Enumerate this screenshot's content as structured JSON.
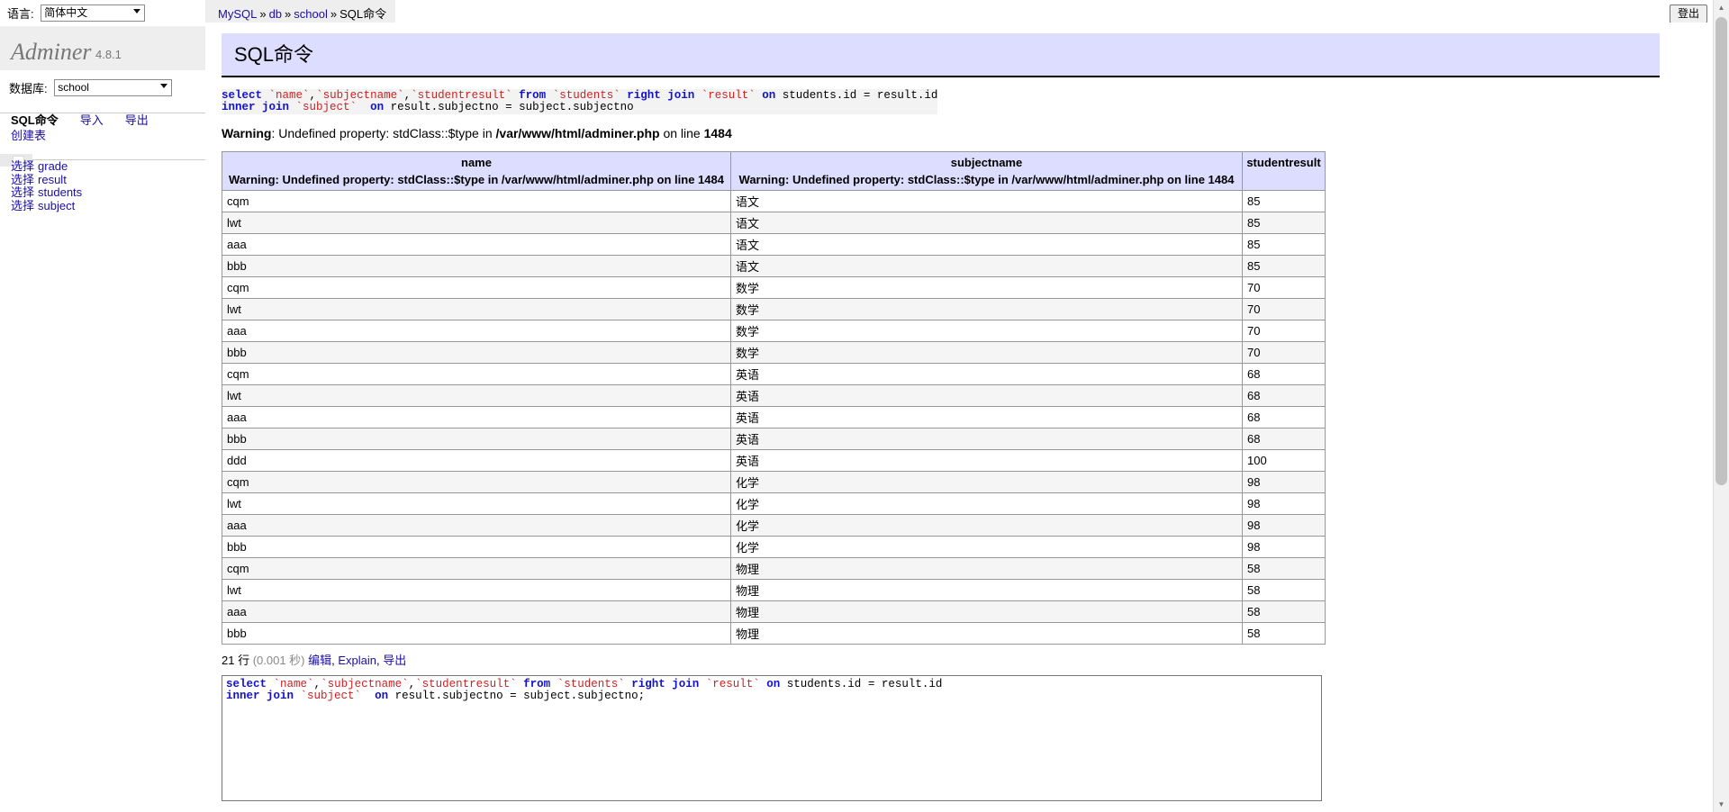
{
  "window": {
    "language_label": "语言:",
    "language_value": "简体中文",
    "logout_label": "登出"
  },
  "breadcrumb": {
    "server": "MySQL",
    "db_link": "db",
    "database": "school",
    "sep": "»",
    "current": "SQL命令"
  },
  "sidebar": {
    "logo": "Adminer",
    "version": "4.8.1",
    "db_label": "数据库:",
    "db_value": "school",
    "nav": {
      "sql_command": "SQL命令",
      "import": "导入",
      "export": "导出",
      "create_table": "创建表"
    },
    "select_label": "选择",
    "tables": [
      {
        "name": "grade"
      },
      {
        "name": "result"
      },
      {
        "name": "students"
      },
      {
        "name": "subject"
      }
    ]
  },
  "main": {
    "title": "SQL命令",
    "query_tokens_line1": [
      {
        "t": "select",
        "c": "kw"
      },
      {
        "t": " ",
        "c": "pl"
      },
      {
        "t": "`name`",
        "c": "id"
      },
      {
        "t": ",",
        "c": "pl"
      },
      {
        "t": "`subjectname`",
        "c": "id"
      },
      {
        "t": ",",
        "c": "pl"
      },
      {
        "t": "`studentresult`",
        "c": "id"
      },
      {
        "t": " ",
        "c": "pl"
      },
      {
        "t": "from",
        "c": "kw"
      },
      {
        "t": " ",
        "c": "pl"
      },
      {
        "t": "`students`",
        "c": "id"
      },
      {
        "t": " ",
        "c": "pl"
      },
      {
        "t": "right join",
        "c": "kw"
      },
      {
        "t": " ",
        "c": "pl"
      },
      {
        "t": "`result`",
        "c": "id"
      },
      {
        "t": " ",
        "c": "pl"
      },
      {
        "t": "on",
        "c": "kw"
      },
      {
        "t": " students.id = result.id",
        "c": "pl"
      }
    ],
    "query_tokens_line2": [
      {
        "t": "inner join",
        "c": "kw"
      },
      {
        "t": " ",
        "c": "pl"
      },
      {
        "t": "`subject`",
        "c": "id"
      },
      {
        "t": "  ",
        "c": "pl"
      },
      {
        "t": "on",
        "c": "kw"
      },
      {
        "t": " result.subjectno = subject.subjectno",
        "c": "pl"
      }
    ],
    "warning": {
      "label": "Warning",
      "colon": ": ",
      "message": "Undefined property: stdClass::$type in ",
      "file": "/var/www/html/adminer.php",
      "on_line": " on line ",
      "line_number": "1484"
    },
    "header_warning_text": "Warning:  Undefined property: stdClass::$type in /var/www/html/adminer.php on line 1484",
    "columns": [
      "name",
      "subjectname",
      "studentresult"
    ],
    "rows": [
      [
        "cqm",
        "语文",
        "85"
      ],
      [
        "lwt",
        "语文",
        "85"
      ],
      [
        "aaa",
        "语文",
        "85"
      ],
      [
        "bbb",
        "语文",
        "85"
      ],
      [
        "cqm",
        "数学",
        "70"
      ],
      [
        "lwt",
        "数学",
        "70"
      ],
      [
        "aaa",
        "数学",
        "70"
      ],
      [
        "bbb",
        "数学",
        "70"
      ],
      [
        "cqm",
        "英语",
        "68"
      ],
      [
        "lwt",
        "英语",
        "68"
      ],
      [
        "aaa",
        "英语",
        "68"
      ],
      [
        "bbb",
        "英语",
        "68"
      ],
      [
        "ddd",
        "英语",
        "100"
      ],
      [
        "cqm",
        "化学",
        "98"
      ],
      [
        "lwt",
        "化学",
        "98"
      ],
      [
        "aaa",
        "化学",
        "98"
      ],
      [
        "bbb",
        "化学",
        "98"
      ],
      [
        "cqm",
        "物理",
        "58"
      ],
      [
        "lwt",
        "物理",
        "58"
      ],
      [
        "aaa",
        "物理",
        "58"
      ],
      [
        "bbb",
        "物理",
        "58"
      ]
    ],
    "footer": {
      "row_count": "21 行",
      "duration": "(0.001 秒)",
      "edit": "编辑",
      "explain": "Explain",
      "export": "导出",
      "comma": ", "
    },
    "editor_tokens_line1": [
      {
        "t": "select",
        "c": "kw"
      },
      {
        "t": " ",
        "c": "pl"
      },
      {
        "t": "`name`",
        "c": "id"
      },
      {
        "t": ",",
        "c": "pl"
      },
      {
        "t": "`subjectname`",
        "c": "id"
      },
      {
        "t": ",",
        "c": "pl"
      },
      {
        "t": "`studentresult`",
        "c": "id"
      },
      {
        "t": " ",
        "c": "pl"
      },
      {
        "t": "from",
        "c": "kw"
      },
      {
        "t": " ",
        "c": "pl"
      },
      {
        "t": "`students`",
        "c": "id"
      },
      {
        "t": " ",
        "c": "pl"
      },
      {
        "t": "right join",
        "c": "kw"
      },
      {
        "t": " ",
        "c": "pl"
      },
      {
        "t": "`result`",
        "c": "id"
      },
      {
        "t": " ",
        "c": "pl"
      },
      {
        "t": "on",
        "c": "kw"
      },
      {
        "t": " students.id = result.id",
        "c": "pl"
      }
    ],
    "editor_tokens_line2": [
      {
        "t": "inner join",
        "c": "kw"
      },
      {
        "t": " ",
        "c": "pl"
      },
      {
        "t": "`subject`",
        "c": "id"
      },
      {
        "t": "  ",
        "c": "pl"
      },
      {
        "t": "on",
        "c": "kw"
      },
      {
        "t": " result.subjectno = subject.subjectno;",
        "c": "pl"
      }
    ]
  },
  "colors": {
    "accent_header": "#ddf",
    "link": "#1a0dab",
    "keyword": "#1212cc",
    "identifier": "#cc2222",
    "sidebar_logo_bg": "#eee"
  }
}
